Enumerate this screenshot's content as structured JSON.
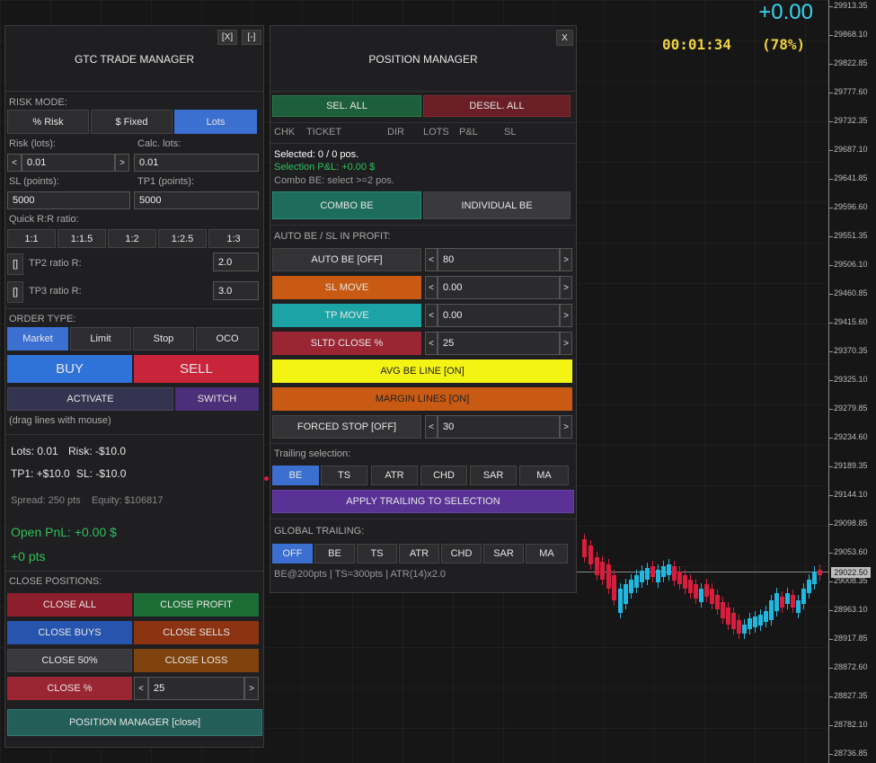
{
  "colors": {
    "blue": "#3b6fd0",
    "red": "#b3243a",
    "green": "#1b7a4d",
    "teal": "#1e6d5c",
    "orange": "#c85a14",
    "yellow": "#f4f414",
    "purple": "#5a3296",
    "bull": "#20b8e0",
    "bear": "#d81e3c"
  },
  "chart": {
    "pnl": "+0.00",
    "timer": "00:01:34",
    "percent": "(78%)",
    "price_label": "29022.50",
    "ticks": [
      "29913.35",
      "29868.10",
      "29822.85",
      "29777.60",
      "29732.35",
      "29687.10",
      "29641.85",
      "29596.60",
      "29551.35",
      "29506.10",
      "29460.85",
      "29415.60",
      "29370.35",
      "29325.10",
      "29279.85",
      "29234.60",
      "29189.35",
      "29144.10",
      "29098.85",
      "29053.60",
      "29008.35",
      "28963.10",
      "28917.85",
      "28872.60",
      "28827.35",
      "28782.10",
      "28736.85"
    ]
  },
  "gtc": {
    "title": "GTC TRADE MANAGER",
    "btn_x": "[X]",
    "btn_min": "[-]",
    "risk_mode_label": "RISK MODE:",
    "risk_modes": [
      "% Risk",
      "$ Fixed",
      "Lots"
    ],
    "risk_label": "Risk (lots):",
    "risk_value": "0.01",
    "calc_label": "Calc. lots:",
    "calc_value": "0.01",
    "sl_label": "SL (points):",
    "sl_value": "5000",
    "tp1_label": "TP1 (points):",
    "tp1_value": "5000",
    "rr_label": "Quick R:R ratio:",
    "rr": [
      "1:1",
      "1:1.5",
      "1:2",
      "1:2.5",
      "1:3"
    ],
    "tp2_check": "[]",
    "tp2_label": "TP2 ratio R:",
    "tp2_value": "2.0",
    "tp3_check": "[]",
    "tp3_label": "TP3 ratio R:",
    "tp3_value": "3.0",
    "order_type_label": "ORDER TYPE:",
    "order_types": [
      "Market",
      "Limit",
      "Stop",
      "OCO"
    ],
    "buy": "BUY",
    "sell": "SELL",
    "activate": "ACTIVATE",
    "switch": "SWITCH",
    "drag_hint": "(drag lines with mouse)",
    "lots_info": "Lots: 0.01",
    "risk_info": "Risk: -$10.0",
    "tp1_info": "TP1: +$10.0",
    "sl_info": "SL: -$10.0",
    "spread_info": "Spread: 250 pts",
    "equity_info": "Equity: $106817",
    "open_pnl": "Open PnL: +0.00 $",
    "pts": "+0 pts",
    "close_label": "CLOSE POSITIONS:",
    "close_all": "CLOSE ALL",
    "close_profit": "CLOSE PROFIT",
    "close_buys": "CLOSE BUYS",
    "close_sells": "CLOSE SELLS",
    "close_50": "CLOSE 50%",
    "close_loss": "CLOSE LOSS",
    "close_pct": "CLOSE %",
    "close_pct_value": "25",
    "pos_mgr": "POSITION MANAGER  [close]",
    "arrow_left": "<",
    "arrow_right": ">"
  },
  "pm": {
    "title": "POSITION MANAGER",
    "btn_x": "X",
    "sel_all": "SEL. ALL",
    "desel_all": "DESEL. ALL",
    "cols": [
      "CHK",
      "TICKET",
      "DIR",
      "LOTS",
      "P&L",
      "SL"
    ],
    "selected": "Selected: 0 / 0 pos.",
    "sel_pnl": "Selection P&L: +0.00 $",
    "combo_hint": "Combo BE: select >=2 pos.",
    "combo_be": "COMBO BE",
    "individual_be": "INDIVIDUAL BE",
    "auto_label": "AUTO BE / SL IN PROFIT:",
    "auto_be": "AUTO BE  [OFF]",
    "auto_be_value": "80",
    "sl_move": "SL MOVE",
    "sl_move_value": "0.00",
    "tp_move": "TP MOVE",
    "tp_move_value": "0.00",
    "sltd_close": "SLTD CLOSE %",
    "sltd_value": "25",
    "avg_be": "AVG BE LINE  [ON]",
    "margin_lines": "MARGIN LINES  [ON]",
    "forced_stop": "FORCED STOP [OFF]",
    "forced_value": "30",
    "trailing_label": "Trailing selection:",
    "trailing": [
      "BE",
      "TS",
      "ATR",
      "CHD",
      "SAR",
      "MA"
    ],
    "apply": "APPLY TRAILING TO SELECTION",
    "global_label": "GLOBAL TRAILING:",
    "global": [
      "OFF",
      "BE",
      "TS",
      "ATR",
      "CHD",
      "SAR",
      "MA"
    ],
    "footer": "BE@200pts | TS=300pts | ATR(14)x2.0",
    "arrow_left": "<",
    "arrow_right": ">"
  }
}
